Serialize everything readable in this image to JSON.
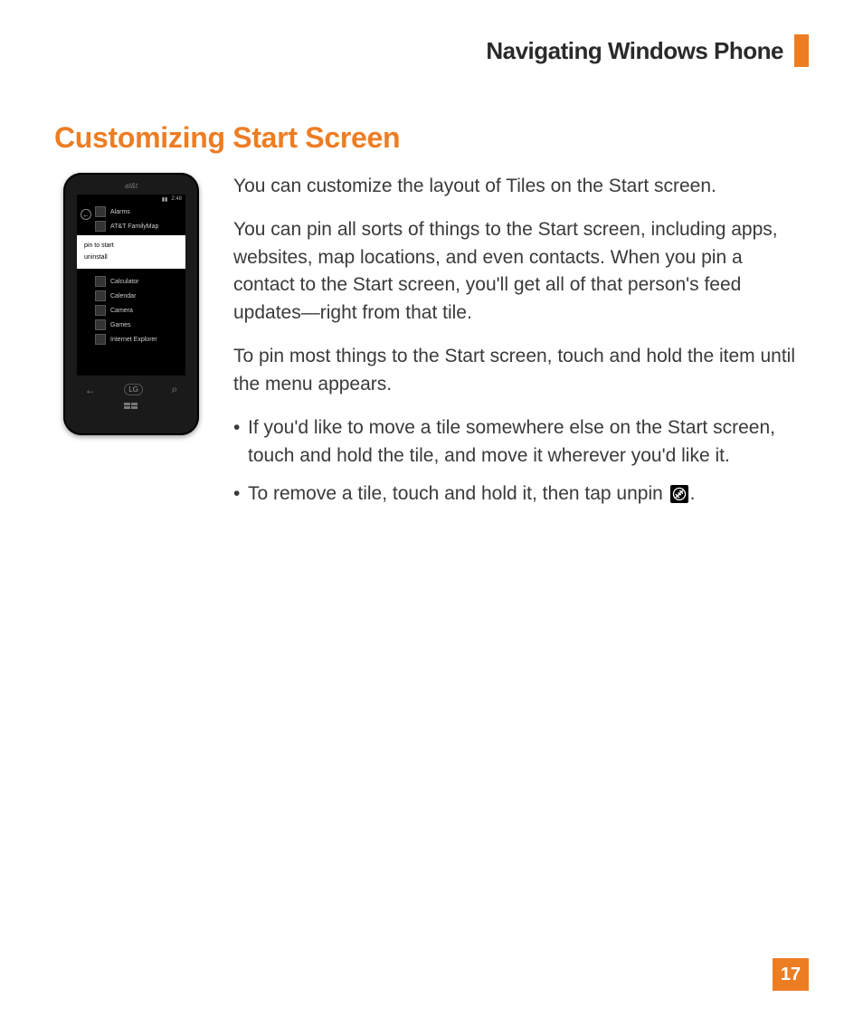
{
  "header": {
    "title": "Navigating Windows Phone"
  },
  "section": {
    "title": "Customizing Start Screen"
  },
  "body": {
    "p1": "You can customize the layout of Tiles on the Start screen.",
    "p2": "You can pin all sorts of things to the Start screen, including apps, websites, map locations, and even contacts. When you pin a contact to the Start screen, you'll get all of that person's feed updates—right from that tile.",
    "p3": "To pin most things to the Start screen, touch and hold the item until the menu appears.",
    "bullet1": "If you'd like to move a tile somewhere else on the Start screen, touch and hold the tile, and move it wherever you'd like it.",
    "bullet2_pre": "To remove a tile, touch and hold it, then tap unpin ",
    "bullet2_post": "."
  },
  "phone": {
    "carrier": "at&t",
    "time": "2:48",
    "menu": {
      "opt1": "pin to start",
      "opt2": "uninstall"
    },
    "apps": {
      "a1": "Alarms",
      "a2": "AT&T FamilyMap",
      "a3": "Calculator",
      "a4": "Calendar",
      "a5": "Camera",
      "a6": "Games",
      "a7": "Internet Explorer"
    },
    "logo": "LG"
  },
  "icons": {
    "unpin": "unpin-icon"
  },
  "page_number": "17"
}
